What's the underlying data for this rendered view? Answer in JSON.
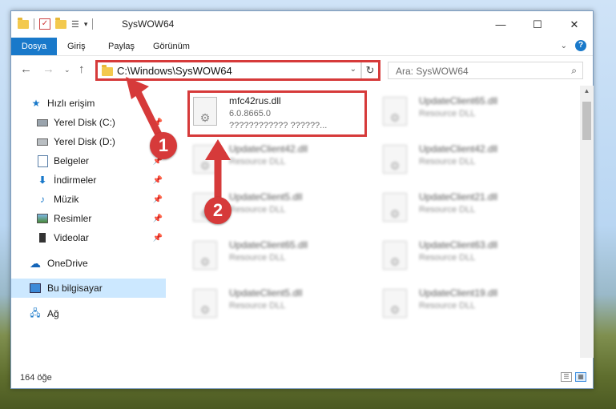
{
  "window": {
    "title": "SysWOW64",
    "controls": {
      "minimize": "—",
      "maximize": "☐",
      "close": "✕"
    }
  },
  "ribbon": {
    "tabs": [
      "Dosya",
      "Giriş",
      "Paylaş",
      "Görünüm"
    ],
    "help": "?"
  },
  "address": {
    "path": "C:\\Windows\\SysWOW64",
    "search_placeholder": "Ara: SysWOW64"
  },
  "sidebar": {
    "items": [
      {
        "label": "Hızlı erişim",
        "icon": "star-icon",
        "pinned": false
      },
      {
        "label": "Yerel Disk (C:)",
        "icon": "drive-icon",
        "pinned": true
      },
      {
        "label": "Yerel Disk (D:)",
        "icon": "drive-icon",
        "pinned": true
      },
      {
        "label": "Belgeler",
        "icon": "documents-icon",
        "pinned": true
      },
      {
        "label": "İndirmeler",
        "icon": "download-icon",
        "pinned": true
      },
      {
        "label": "Müzik",
        "icon": "music-icon",
        "pinned": true
      },
      {
        "label": "Resimler",
        "icon": "pictures-icon",
        "pinned": true
      },
      {
        "label": "Videolar",
        "icon": "video-icon",
        "pinned": true
      },
      {
        "label": "OneDrive",
        "icon": "cloud-icon",
        "pinned": false
      },
      {
        "label": "Bu bilgisayar",
        "icon": "computer-icon",
        "pinned": false
      },
      {
        "label": "Ağ",
        "icon": "network-icon",
        "pinned": false
      }
    ]
  },
  "files": {
    "highlighted": {
      "name": "mfc42rus.dll",
      "version": "6.0.8665.0",
      "description": "???????????? ??????..."
    },
    "others": [
      {
        "name": "UpdateClient65.dll",
        "desc": "Resource DLL"
      },
      {
        "name": "UpdateClient42.dll",
        "desc": "Resource DLL"
      },
      {
        "name": "UpdateClient42.dll",
        "desc": "Resource DLL"
      },
      {
        "name": "UpdateClient5.dll",
        "desc": "Resource DLL"
      },
      {
        "name": "UpdateClient21.dll",
        "desc": "Resource DLL"
      },
      {
        "name": "UpdateClient65.dll",
        "desc": "Resource DLL"
      },
      {
        "name": "UpdateClient63.dll",
        "desc": "Resource DLL"
      },
      {
        "name": "UpdateClient5.dll",
        "desc": "Resource DLL"
      },
      {
        "name": "UpdateClient19.dll",
        "desc": "Resource DLL"
      }
    ]
  },
  "status": {
    "count": "164 öğe"
  },
  "callouts": [
    "1",
    "2"
  ],
  "colors": {
    "accent": "#1979ca",
    "highlight": "#d63a3a",
    "selected": "#cce8ff"
  }
}
